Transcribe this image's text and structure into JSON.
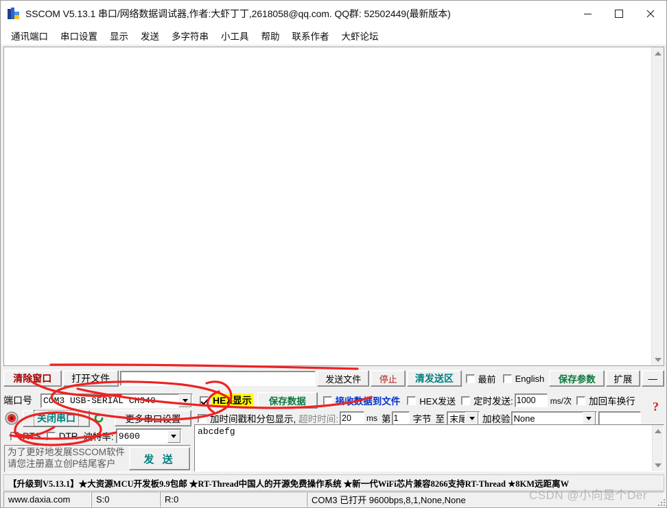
{
  "window": {
    "title": "SSCOM V5.13.1 串口/网络数据调试器,作者:大虾丁丁,2618058@qq.com. QQ群: 52502449(最新版本)",
    "minimize_label": "—",
    "maximize_label": "□",
    "close_label": "✕",
    "app_icon": "sscom-app-icon"
  },
  "menubar": {
    "items": [
      {
        "label": "通讯端口"
      },
      {
        "label": "串口设置"
      },
      {
        "label": "显示"
      },
      {
        "label": "发送"
      },
      {
        "label": "多字符串"
      },
      {
        "label": "小工具"
      },
      {
        "label": "帮助"
      },
      {
        "label": "联系作者"
      },
      {
        "label": "大虾论坛"
      }
    ]
  },
  "receive_area": {
    "text": "",
    "scroll_up_icon": "triangle-up-icon",
    "scroll_down_icon": "triangle-down-icon"
  },
  "toolbar_row": {
    "clear_window_label": "清除窗口",
    "open_file_label": "打开文件",
    "file_path_value": "",
    "send_file_label": "发送文件",
    "stop_label": "停止",
    "clear_send_label": "清发送区",
    "topmost_label": "最前",
    "topmost_checked": false,
    "english_label": "English",
    "english_checked": false,
    "save_params_label": "保存参数",
    "extend_label": "扩展",
    "collapse_label": "—"
  },
  "port_row": {
    "port_label": "端口号",
    "port_value": "COM3  USB-SERIAL CH340",
    "hex_display_label": "HEX显示",
    "hex_display_checked": true,
    "save_data_label": "保存数据",
    "recv_to_file_label": "接收数据到文件",
    "recv_to_file_checked": false,
    "hex_send_label": "HEX发送",
    "hex_send_checked": false,
    "timed_send_label": "定时发送:",
    "timed_send_checked": false,
    "timed_send_value": "1000",
    "ms_per_label": "ms/次",
    "crlf_label": "加回车换行",
    "crlf_checked": false
  },
  "control_row": {
    "close_port_label": "关闭串口",
    "more_settings_label": "更多串口设置",
    "timestamp_label": "加时间戳和分包显示,",
    "timestamp_checked": false,
    "timeout_label": "超时时间:",
    "timeout_value": "20",
    "timeout_unit": "ms",
    "byte_from_label": "第",
    "byte_from_value": "1",
    "byte_label": "字节",
    "to_label": "至",
    "byte_to_value": "末尾",
    "checksum_label": "加校验",
    "checksum_value": "None",
    "extra_value": "",
    "led_icon": "status-led-icon",
    "refresh_icon": "refresh-arrow-icon",
    "help_icon": "question-mark-icon"
  },
  "baud_row": {
    "rts_label": "RTS",
    "rts_checked": false,
    "dtr_label": "DTR",
    "dtr_checked": false,
    "baud_label": "波特率:",
    "baud_value": "9600"
  },
  "send_panel": {
    "promo_line1": "为了更好地发展SSCOM软件",
    "promo_line2": "请您注册嘉立创P结尾客户",
    "send_button_label": "发 送",
    "send_text": "abcdefg"
  },
  "ad_bar": {
    "text": "【升级到V5.13.1】★大资源MCU开发板9.9包邮  ★RT-Thread中国人的开源免费操作系统  ★新一代WiFi芯片兼容8266支持RT-Thread  ★8KM远距离W"
  },
  "status_bar": {
    "website": "www.daxia.com",
    "sent": "S:0",
    "received": "R:0",
    "port_status": "COM3 已打开  9600bps,8,1,None,None"
  },
  "watermark": {
    "text": "CSDN @小向是个Der"
  },
  "colors": {
    "accent_red": "#a00000",
    "accent_green": "#0a7a3c",
    "accent_teal": "#007f7f",
    "accent_blue": "#0033cc",
    "highlight_yellow": "#ffff00",
    "annotation_red": "#ee2222",
    "window_bg": "#f0f0f0"
  }
}
